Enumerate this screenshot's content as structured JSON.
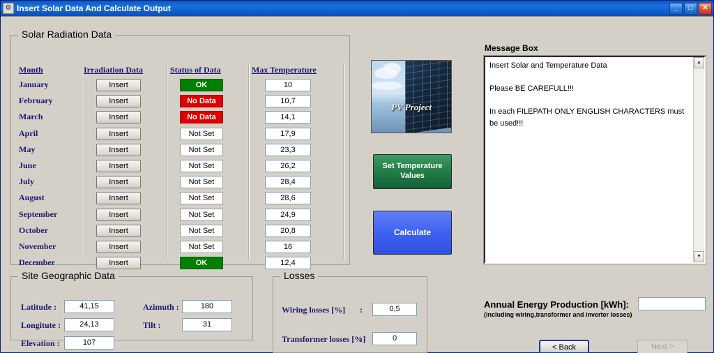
{
  "window": {
    "title": "Insert Solar Data And Calculate Output",
    "icon": "gear-icon",
    "minimize": "_",
    "maximize": "□",
    "close": "✕"
  },
  "solar_group": {
    "legend": "Solar Radiation Data",
    "columns": [
      "Month",
      "Irradiation Data",
      "Status of Data",
      "Max Temperature"
    ],
    "rows": [
      {
        "month": "January",
        "insert": "Insert",
        "status": "OK",
        "status_kind": "ok",
        "temp": "10"
      },
      {
        "month": "February",
        "insert": "Insert",
        "status": "No Data",
        "status_kind": "nodata",
        "temp": "10,7"
      },
      {
        "month": "March",
        "insert": "Insert",
        "status": "No Data",
        "status_kind": "nodata",
        "temp": "14,1"
      },
      {
        "month": "April",
        "insert": "Insert",
        "status": "Not Set",
        "status_kind": "notset",
        "temp": "17,9"
      },
      {
        "month": "May",
        "insert": "Insert",
        "status": "Not Set",
        "status_kind": "notset",
        "temp": "23,3"
      },
      {
        "month": "June",
        "insert": "Insert",
        "status": "Not Set",
        "status_kind": "notset",
        "temp": "26,2"
      },
      {
        "month": "July",
        "insert": "Insert",
        "status": "Not Set",
        "status_kind": "notset",
        "temp": "28,4"
      },
      {
        "month": "August",
        "insert": "Insert",
        "status": "Not Set",
        "status_kind": "notset",
        "temp": "28,6"
      },
      {
        "month": "September",
        "insert": "Insert",
        "status": "Not Set",
        "status_kind": "notset",
        "temp": "24,9"
      },
      {
        "month": "October",
        "insert": "Insert",
        "status": "Not Set",
        "status_kind": "notset",
        "temp": "20,8"
      },
      {
        "month": "November",
        "insert": "Insert",
        "status": "Not Set",
        "status_kind": "notset",
        "temp": "16"
      },
      {
        "month": "December",
        "insert": "Insert",
        "status": "OK",
        "status_kind": "ok",
        "temp": "12,4"
      }
    ]
  },
  "pv_image": {
    "caption": "PV Project"
  },
  "actions": {
    "set_temperature": "Set Temperature\nValues",
    "set_temperature_line1": "Set Temperature",
    "set_temperature_line2": "Values",
    "calculate": "Calculate"
  },
  "message_box": {
    "label": "Message Box",
    "text": "Insert Solar and Temperature Data\n\nPlease BE CAREFULL!!!\n\nIn each FILEPATH ONLY ENGLISH CHARACTERS must be used!!!",
    "scroll_up": "▲",
    "scroll_down": "▼"
  },
  "site_group": {
    "legend": "Site Geographic Data",
    "fields": [
      {
        "label": "Latitude  :",
        "value": "41,15"
      },
      {
        "label": "Longitute :",
        "value": "24,13"
      },
      {
        "label": "Elevation :",
        "value": "107"
      },
      {
        "label": "Azimuth :",
        "value": "180"
      },
      {
        "label": "Tilt        :",
        "value": "31"
      }
    ]
  },
  "losses_group": {
    "legend": "Losses",
    "fields": [
      {
        "label": "Wiring losses [%]",
        "sep": ":",
        "value": "0,5"
      },
      {
        "label": "Transformer losses [%]",
        "sep": ":",
        "value": "0"
      }
    ]
  },
  "annual": {
    "label": "Annual Energy Production [kWh]:",
    "sublabel": "(including wiring,transformer and inverter losses)",
    "value": ""
  },
  "nav": {
    "back": "< Back",
    "next": "Next >"
  },
  "colors": {
    "title_blue": "#0b57c8",
    "status_ok": "#008000",
    "status_nodata": "#e00000",
    "button_green": "#1f7a43",
    "button_blue": "#3d5ff0",
    "label_navy": "#1a1a6e"
  }
}
